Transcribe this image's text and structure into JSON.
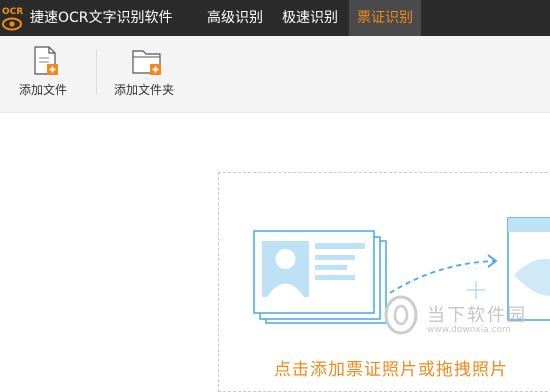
{
  "app": {
    "logo_text": "OCR",
    "title": "捷速OCR文字识别软件"
  },
  "tabs": [
    {
      "label": "高级识别",
      "active": false
    },
    {
      "label": "极速识别",
      "active": false
    },
    {
      "label": "票证识别",
      "active": true
    }
  ],
  "toolbar": {
    "add_file_label": "添加文件",
    "add_folder_label": "添加文件夹"
  },
  "main": {
    "hint_text": "点击添加票证照片或拖拽照片"
  },
  "watermark": {
    "text": "当下软件园",
    "url": "www.downxia.com"
  },
  "colors": {
    "titlebar": "#2b2b2b",
    "accent": "#f08a1c",
    "illustration": "#45a9e6"
  },
  "icons": {
    "logo": "ocr-eye-logo-icon",
    "add_file": "file-add-icon",
    "add_folder": "folder-add-icon",
    "move": "move-cursor-icon"
  }
}
